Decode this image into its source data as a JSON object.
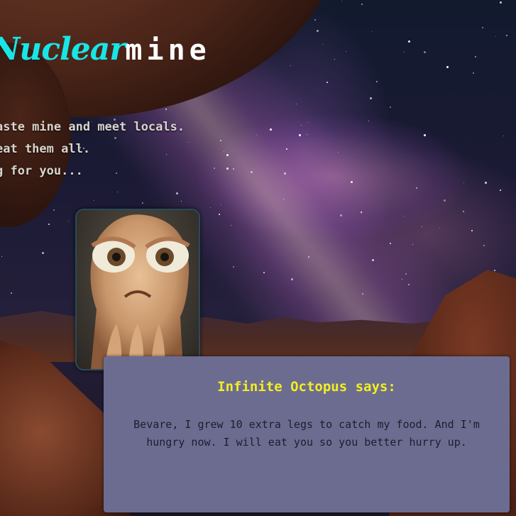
{
  "game": {
    "logo_part1": "Nuclear",
    "logo_part2": "mine"
  },
  "intro_lines": [
    "aste mine and meet locals.",
    "eat them all.",
    "g for you..."
  ],
  "portrait": {
    "icon": "octopus-portrait-icon"
  },
  "dialog": {
    "speaker": "Infinite Octopus says:",
    "message": "Bevare, I grew 10 extra legs to catch my food. And I'm hungry now. I will eat you so you better hurry up."
  },
  "colors": {
    "logo_accent": "#18e6e6",
    "speaker_name": "#f2ee22",
    "dialog_bg": "#6c6c90"
  }
}
